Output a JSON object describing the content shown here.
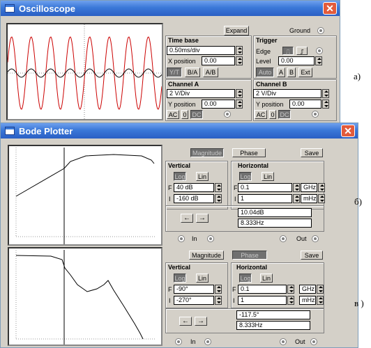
{
  "oscilloscope": {
    "title": "Oscilloscope",
    "expand": "Expand",
    "ground": "Ground",
    "timebase": {
      "label": "Time base",
      "value": "0.50ms/div",
      "xpos_label": "X position",
      "xpos": "0.00",
      "yt": "Y/T",
      "ba": "B/A",
      "ab": "A/B"
    },
    "trigger": {
      "label": "Trigger",
      "edge": "Edge",
      "level_label": "Level",
      "level": "0.00",
      "auto": "Auto",
      "a": "A",
      "b": "B",
      "ext": "Ext"
    },
    "channel_a": {
      "label": "Channel A",
      "value": "2  V/Div",
      "ypos_label": "Y position",
      "ypos": "0.00",
      "ac": "AC",
      "zero": "0",
      "dc": "DC"
    },
    "channel_b": {
      "label": "Channel B",
      "value": "2  V/Div",
      "ypos_label": "Y position",
      "ypos": "0.00",
      "ac": "AC",
      "zero": "0",
      "dc": "DC"
    },
    "side_label": "a)"
  },
  "bode1": {
    "title": "Bode Plotter",
    "magnitude": "Magnitude",
    "phase": "Phase",
    "save": "Save",
    "vertical": "Vertical",
    "horizontal": "Horizontal",
    "log": "Log",
    "lin": "Lin",
    "f": "F",
    "i": "I",
    "v_f": "40 dB",
    "v_i": "-160 dB",
    "h_f": "0.1",
    "h_i": "1",
    "h_f_unit": "GHz",
    "h_i_unit": "mHz",
    "readout_value": "10.04dB",
    "readout_freq": "8.333Hz",
    "in": "In",
    "out": "Out",
    "side_label": "б)"
  },
  "bode2": {
    "magnitude": "Magnitude",
    "phase": "Phase",
    "save": "Save",
    "vertical": "Vertical",
    "horizontal": "Horizontal",
    "log": "Log",
    "lin": "Lin",
    "f": "F",
    "i": "I",
    "v_f": "-90°",
    "v_i": "-270°",
    "h_f": "0.1",
    "h_i": "1",
    "h_f_unit": "GHz",
    "h_i_unit": "mHz",
    "readout_value": "-117.5°",
    "readout_freq": "8.333Hz",
    "in": "In",
    "out": "Out",
    "side_label": "в )"
  },
  "colors": {
    "title_bar": "#3b78d8",
    "window_bg": "#d4d0c8",
    "trace_a": "#cc0000",
    "trace_b": "#000000",
    "close": "#e25b3b"
  }
}
